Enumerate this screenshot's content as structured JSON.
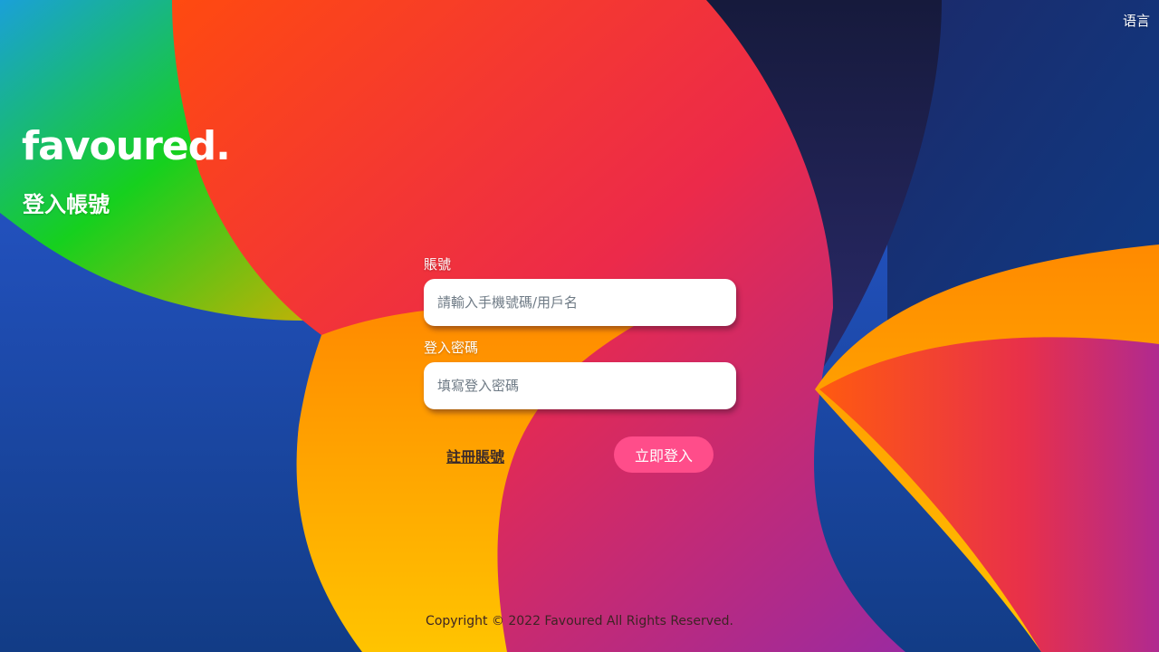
{
  "header": {
    "language_label": "语言"
  },
  "brand": {
    "logo_text": "favoured.",
    "page_title": "登入帳號"
  },
  "form": {
    "account": {
      "label": "賬號",
      "value": "",
      "placeholder": "請輸入手機號碼/用戶名"
    },
    "password": {
      "label": "登入密碼",
      "value": "",
      "placeholder": "填寫登入密碼"
    },
    "register_link": "註冊賬號",
    "login_button": "立即登入"
  },
  "footer": {
    "copyright": "Copyright © 2022 Favoured All Rights Reserved."
  },
  "colors": {
    "accent_button": "#ff4d8a",
    "text_light": "#ffffff",
    "text_dark": "#3d2424"
  }
}
